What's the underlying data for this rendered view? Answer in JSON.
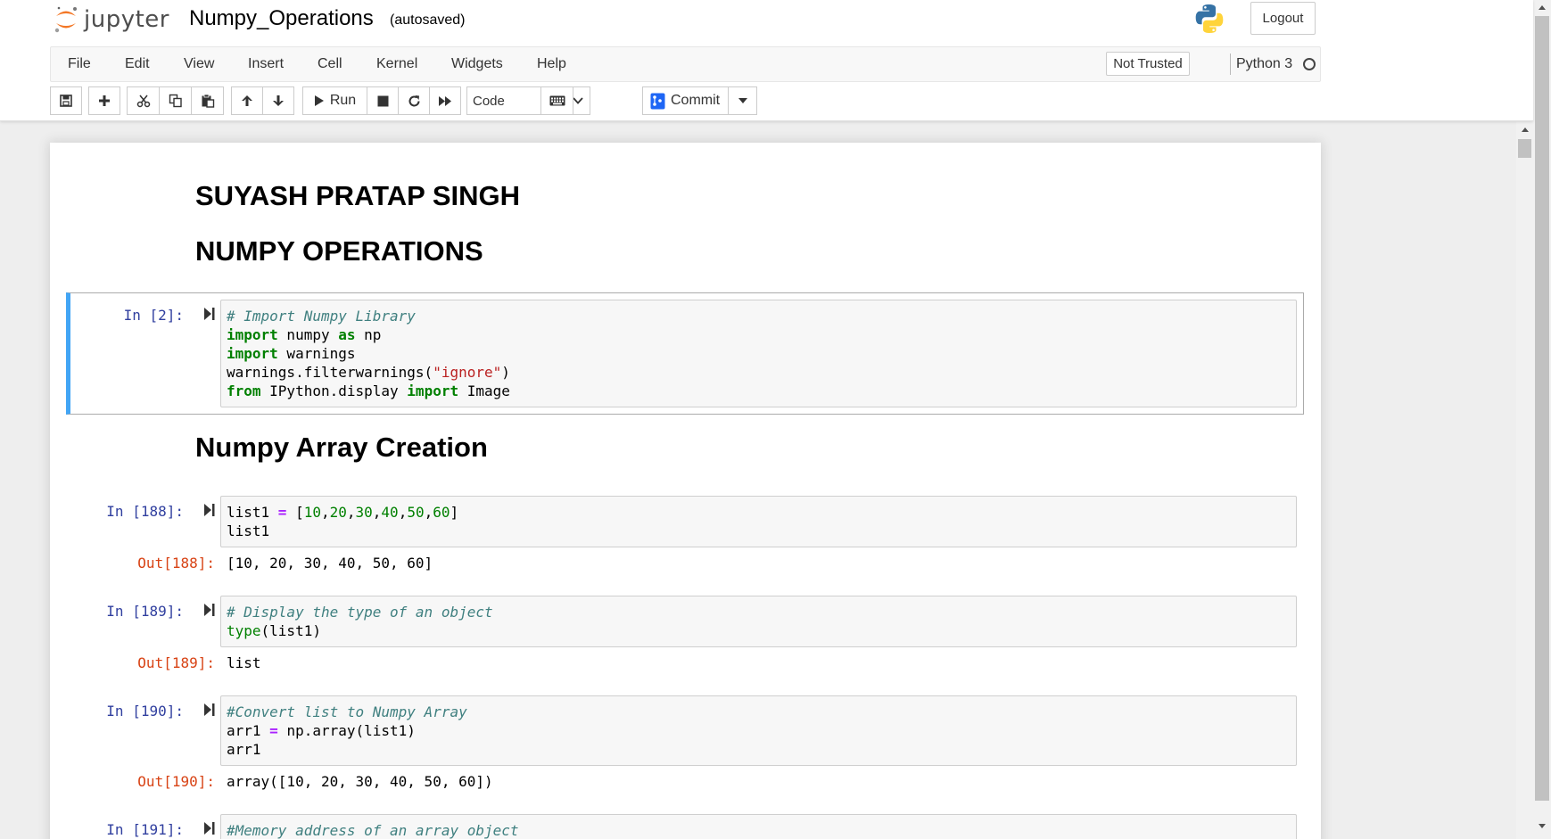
{
  "header": {
    "logo_text": "jupyter",
    "notebook_name": "Numpy_Operations",
    "autosave_status": "(autosaved)",
    "logout_label": "Logout",
    "logo_icon": "jupyter-logo-icon",
    "python_icon": "python-logo-icon"
  },
  "menubar": {
    "items": [
      "File",
      "Edit",
      "View",
      "Insert",
      "Cell",
      "Kernel",
      "Widgets",
      "Help"
    ],
    "trusted_label": "Not Trusted",
    "kernel_name": "Python 3",
    "kernel_indicator": "kernel-idle-circle-icon"
  },
  "toolbar": {
    "buttons": [
      "save-icon",
      "plus-icon",
      "cut-icon",
      "copy-icon",
      "paste-icon",
      "arrow-up-icon",
      "arrow-down-icon",
      "run-icon",
      "stop-icon",
      "restart-icon",
      "fast-forward-icon",
      "keyboard-icon"
    ],
    "run_label": "Run",
    "cell_type": "Code",
    "commit_label": "Commit"
  },
  "notebook": {
    "heading1": "SUYASH PRATAP SINGH",
    "heading2": "NUMPY OPERATIONS",
    "heading3": "Numpy Array Creation",
    "cells": [
      {
        "prompt": "In [2]:",
        "lines": [
          "# Import Numpy Library",
          "import numpy as np",
          "import warnings",
          "warnings.filterwarnings(\"ignore\")",
          "from IPython.display import Image"
        ]
      },
      {
        "prompt": "In [188]:",
        "lines": [
          "list1 = [10,20,30,40,50,60]",
          "list1"
        ],
        "out_prompt": "Out[188]:",
        "output": "[10, 20, 30, 40, 50, 60]"
      },
      {
        "prompt": "In [189]:",
        "lines": [
          "# Display the type of an object",
          "type(list1)"
        ],
        "out_prompt": "Out[189]:",
        "output": "list"
      },
      {
        "prompt": "In [190]:",
        "lines": [
          "#Convert list to Numpy Array",
          "arr1 = np.array(list1)",
          "arr1"
        ],
        "out_prompt": "Out[190]:",
        "output": "array([10, 20, 30, 40, 50, 60])"
      },
      {
        "prompt": "In [191]:",
        "lines": [
          "#Memory address of an array object"
        ]
      }
    ]
  },
  "colors": {
    "selected_border": "#42a5f5",
    "in_prompt": "#303f9f",
    "out_prompt": "#d84315",
    "comment": "#408080",
    "keyword": "#008000",
    "string": "#ba2121",
    "operator": "#aa22ff"
  }
}
